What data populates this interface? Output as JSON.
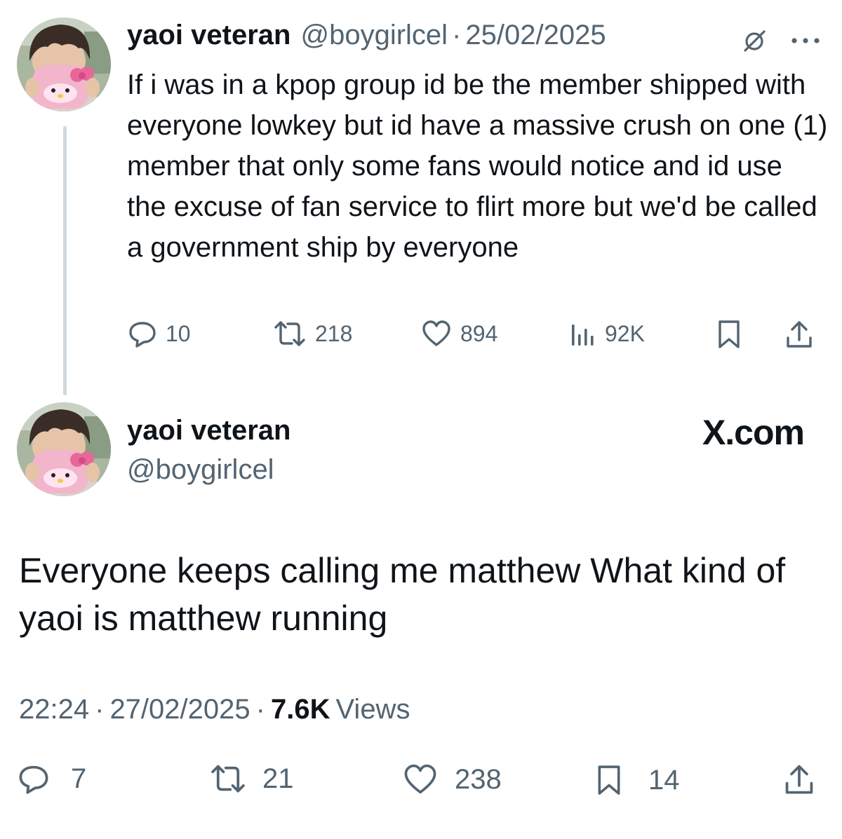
{
  "reply_tweet": {
    "display_name": "yaoi veteran",
    "handle": "@boygirlcel",
    "separator": "·",
    "date": "25/02/2025",
    "text": "If i was in a kpop group id be the member shipped with everyone lowkey but id have a massive crush on one (1) member that only some fans would notice and id use the excuse of fan service to flirt more but we'd be called a government ship by everyone",
    "stats": {
      "replies": "10",
      "reposts": "218",
      "likes": "894",
      "views": "92K"
    }
  },
  "main_tweet": {
    "display_name": "yaoi veteran",
    "handle": "@boygirlcel",
    "platform_label": "X.com",
    "text": "Everyone keeps calling me matthew What kind of yaoi is matthew running",
    "time": "22:24",
    "separator": "·",
    "date": "27/02/2025",
    "views_count": "7.6K",
    "views_label": "Views",
    "stats": {
      "replies": "7",
      "reposts": "21",
      "likes": "238",
      "bookmarks": "14"
    }
  },
  "colors": {
    "text_primary": "#0f1419",
    "text_muted": "#536471",
    "thread_line": "#cfd9de",
    "background": "#ffffff"
  },
  "icons": {
    "reply": "speech-bubble-icon",
    "repost": "repost-arrows-icon",
    "like": "heart-icon",
    "views": "bar-chart-icon",
    "bookmark": "bookmark-icon",
    "share": "share-upload-icon",
    "grok": "slashed-circle-icon",
    "more": "ellipsis-icon"
  }
}
